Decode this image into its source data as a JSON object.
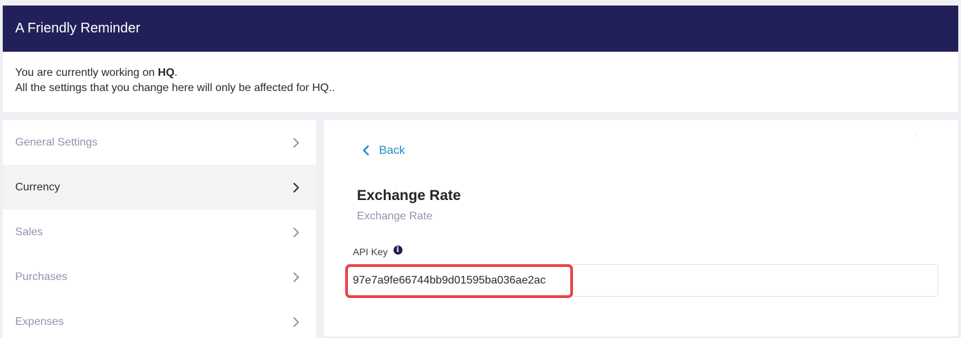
{
  "reminder": {
    "title": "A Friendly Reminder",
    "line1_prefix": "You are currently working on ",
    "line1_bold": "HQ",
    "line1_suffix": ".",
    "line2": "All the settings that you change here will only be affected for HQ.."
  },
  "sidebar": {
    "items": [
      {
        "label": "General Settings",
        "icon": "chevron-right-icon"
      },
      {
        "label": "Currency",
        "icon": "chevron-right-icon",
        "active": true
      },
      {
        "label": "Sales",
        "icon": "chevron-right-icon"
      },
      {
        "label": "Purchases",
        "icon": "chevron-right-icon"
      },
      {
        "label": "Expenses",
        "icon": "chevron-right-icon"
      }
    ]
  },
  "content": {
    "back_label": "Back",
    "title": "Exchange Rate",
    "subtitle": "Exchange Rate",
    "api_key_label": "API Key",
    "api_key_value": "97e7a9fe66744bb9d01595ba036ae2ac"
  },
  "colors": {
    "header_bg": "#222059",
    "link": "#1f8dc2",
    "highlight": "#e84545",
    "muted_text": "#8d96a8"
  }
}
